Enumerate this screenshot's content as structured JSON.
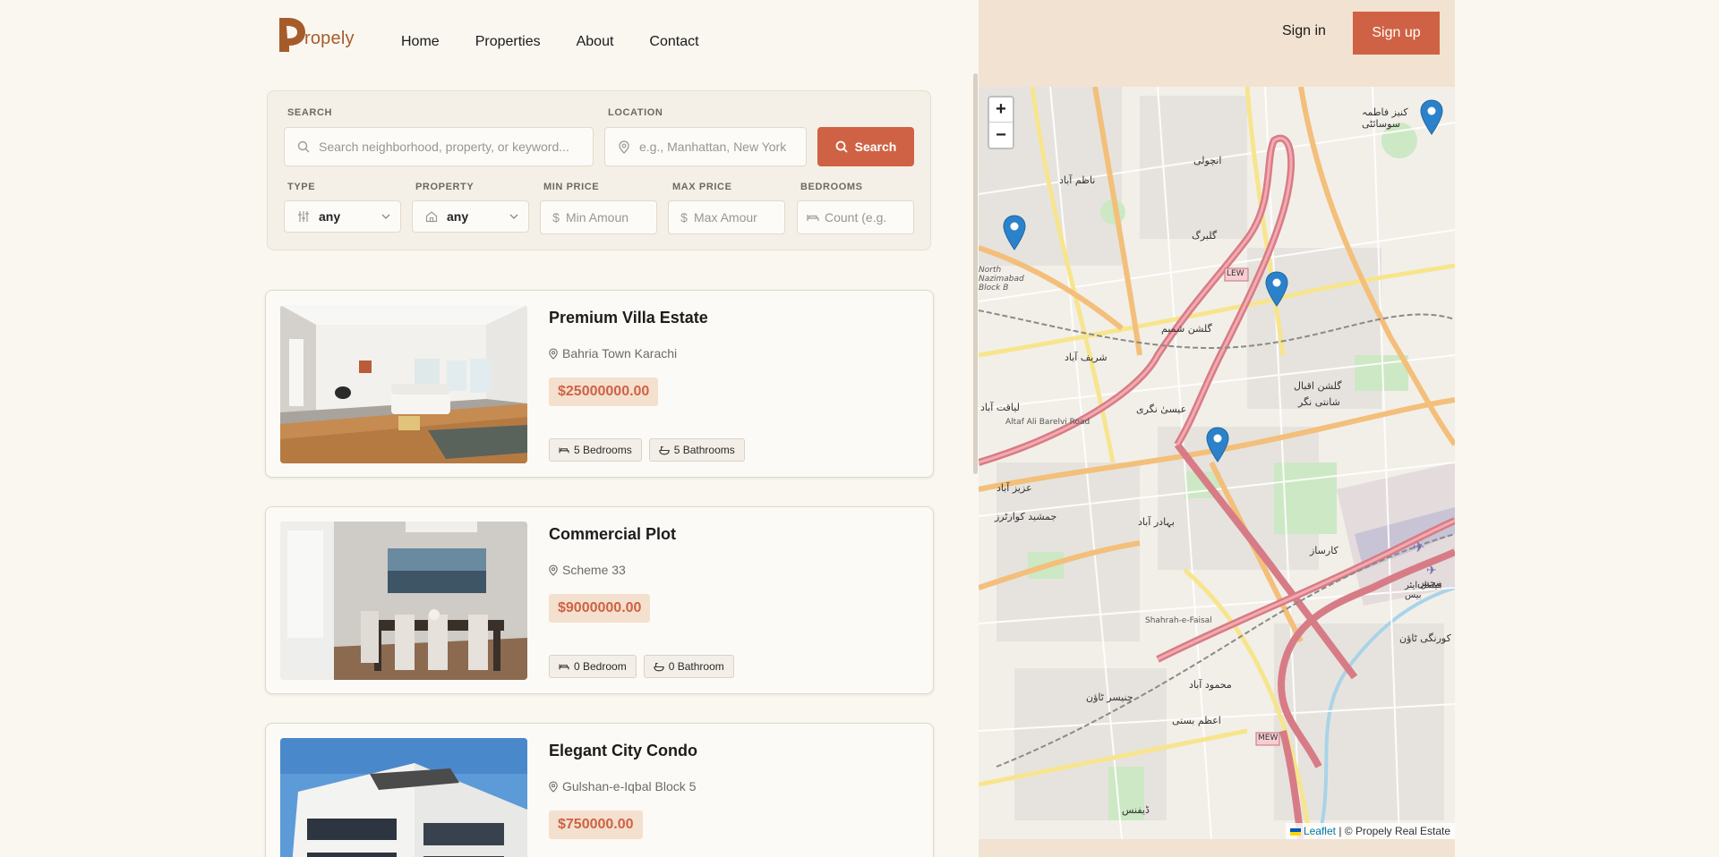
{
  "brand": {
    "name": "ropely"
  },
  "nav": [
    "Home",
    "Properties",
    "About",
    "Contact"
  ],
  "auth": {
    "signin": "Sign in",
    "signup": "Sign up"
  },
  "search": {
    "search_label": "SEARCH",
    "search_placeholder": "Search neighborhood, property, or keyword...",
    "location_label": "LOCATION",
    "location_placeholder": "e.g., Manhattan, New York",
    "button": "Search",
    "type_label": "TYPE",
    "type_value": "any",
    "property_label": "PROPERTY",
    "property_value": "any",
    "min_label": "MIN PRICE",
    "min_placeholder": "Min Amoun",
    "max_label": "MAX PRICE",
    "max_placeholder": "Max Amour",
    "bed_label": "BEDROOMS",
    "bed_placeholder": "Count (e.g."
  },
  "listings": [
    {
      "title": "Premium Villa Estate",
      "location": "Bahria Town Karachi",
      "price": "$25000000.00",
      "beds": "5 Bedrooms",
      "baths": "5 Bathrooms"
    },
    {
      "title": "Commercial Plot",
      "location": "Scheme 33",
      "price": "$9000000.00",
      "beds": "0 Bedroom",
      "baths": "0 Bathroom"
    },
    {
      "title": "Elegant City Condo",
      "location": "Gulshan-e-Iqbal Block 5",
      "price": "$750000.00",
      "beds": "",
      "baths": ""
    }
  ],
  "map": {
    "zoom_in": "+",
    "zoom_out": "−",
    "attribution_link": "Leaflet",
    "attribution_text": "| © Propely Real Estate",
    "labels": {
      "gulberg": "گلبرگ",
      "gulshan_e_iqbal": "گلشن اقبال",
      "shanti_nagar": "شانتی نگر",
      "essa_nagri": "عیسیٰ نگری",
      "karsaz": "کارساز",
      "mehmoodabad": "محمود آباد",
      "bahadurabad": "بہادر آباد",
      "pechs": "پیچس",
      "north_nazimabad": "North Nazimabad Block B",
      "lew": "LEW",
      "mew": "MEW",
      "anchoi": "انچولی",
      "liaquatabad": "لیاقت آباد",
      "aziz": "عزیز آباد",
      "jamshed": "جمشید کوارٹرز",
      "faisal_base": "فیصل ایئر بیس",
      "altaf_road": "Altaf Ali Barelvi Road",
      "shahrah_faisal": "Shahrah-e-Faisal",
      "sharifabad": "شریف آباد",
      "shamim": "گلشن شمیم",
      "nazimabad": "ناظم آباد",
      "kaneez": "کنیز فاطمہ سوسائٹی",
      "chanesar": "چنیسر ٹاؤن",
      "azam_basti": "اعظم بستی",
      "defence": "ڈیفنس",
      "korangi": "کورنگی ٹاؤن"
    }
  },
  "colors": {
    "accent": "#cf6244",
    "header_strip": "#f2e2d1",
    "page": "#faf7f1"
  }
}
